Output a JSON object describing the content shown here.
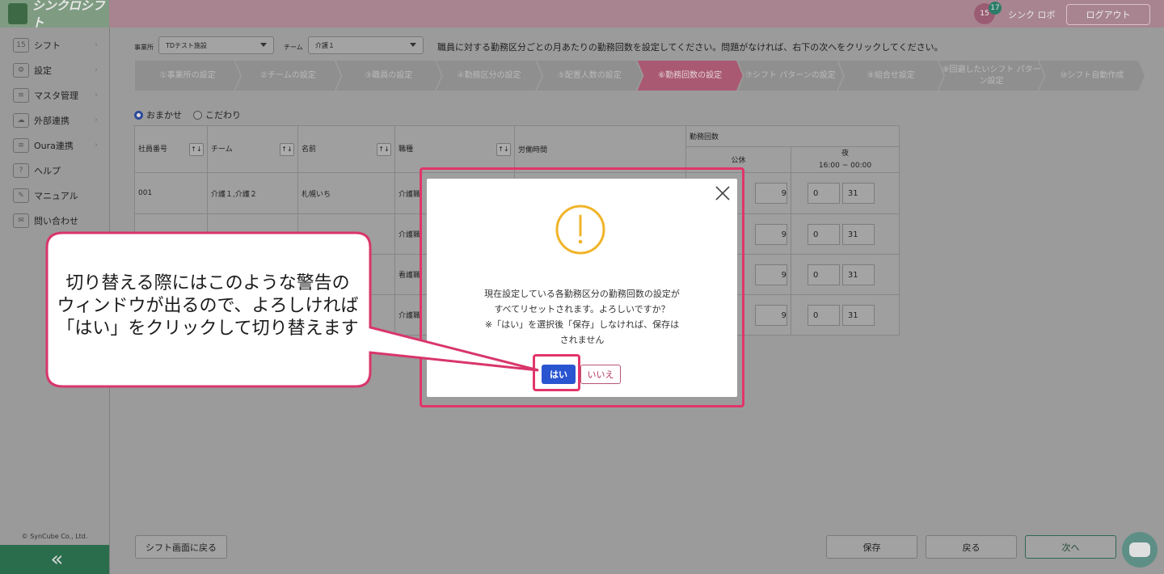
{
  "app": {
    "logo_text": "シンクロシフト",
    "copyright": "© SynCube Co., Ltd.",
    "collapse_symbol": "«"
  },
  "sidebar": {
    "items": [
      {
        "label": "シフト",
        "icon": "calendar-icon"
      },
      {
        "label": "設定",
        "icon": "gear-icon"
      },
      {
        "label": "マスタ管理",
        "icon": "database-icon"
      },
      {
        "label": "外部連携",
        "icon": "cloud-icon"
      },
      {
        "label": "Oura連携",
        "icon": "database-icon"
      },
      {
        "label": "ヘルプ",
        "icon": "help-icon"
      },
      {
        "label": "マニュアル",
        "icon": "edit-icon"
      },
      {
        "label": "問い合わせ",
        "icon": "mail-icon"
      }
    ]
  },
  "header": {
    "calendar_day": "15",
    "notification_count": "17",
    "user_name": "シンク ロボ",
    "logout_label": "ログアウト"
  },
  "filters": {
    "facility_label": "事業所",
    "facility_value": "TDテスト施設",
    "team_label": "チーム",
    "team_value": "介護１"
  },
  "instruction": "職員に対する勤務区分ごとの月あたりの勤務回数を設定してください。問題がなければ、右下の次へをクリックしてください。",
  "steps": [
    {
      "label": "①事業所の設定"
    },
    {
      "label": "②チームの設定"
    },
    {
      "label": "③職員の設定"
    },
    {
      "label": "④勤務区分の設定"
    },
    {
      "label": "⑤配置人数の設定"
    },
    {
      "label": "⑥勤務回数の設定"
    },
    {
      "label": "⑦シフト パターンの設定"
    },
    {
      "label": "⑧組合せ設定"
    },
    {
      "label": "⑨回避したいシフト パターン設定"
    },
    {
      "label": "⑩シフト自動作成"
    }
  ],
  "mode": {
    "option1": "おまかせ",
    "option2": "こだわり",
    "selected": "おまかせ"
  },
  "table": {
    "headers": {
      "id": "社員番号",
      "team": "チーム",
      "name": "名前",
      "job": "職種",
      "hours": "労働時間",
      "counts": "勤務回数",
      "col_off": "公休",
      "col_night": "夜",
      "col_night_time": "16:00 ~ 00:00"
    },
    "rows": [
      {
        "id": "001",
        "team": "介護１,介護２",
        "name": "札幌いち",
        "job": "介護職",
        "off_max": "9",
        "night_min": "0",
        "night_max": "31"
      },
      {
        "id": "",
        "team": "",
        "name": "",
        "job": "介護職",
        "off_max": "9",
        "night_min": "0",
        "night_max": "31"
      },
      {
        "id": "",
        "team": "",
        "name": "",
        "job": "看護職",
        "off_max": "9",
        "night_min": "0",
        "night_max": "31"
      },
      {
        "id": "",
        "team": "",
        "name": "",
        "job": "介護職",
        "off_max": "9",
        "night_min": "0",
        "night_max": "31"
      }
    ]
  },
  "footer": {
    "back_to_shift": "シフト画面に戻る",
    "save": "保存",
    "back": "戻る",
    "next": "次へ"
  },
  "modal": {
    "line1": "現在設定している各勤務区分の勤務回数の設定が",
    "line2": "すべてリセットされます。よろしいですか？",
    "line3": "※「はい」を選択後「保存」しなければ、保存は",
    "line4": "されません",
    "yes": "はい",
    "no": "いいえ"
  },
  "callout": {
    "line1": "切り替える際にはこのような警告の",
    "line2": "ウィンドウが出るので、よろしければ",
    "line3": "「はい」をクリックして切り替えます"
  },
  "colors": {
    "highlight": "#e2356a",
    "primary_button": "#2a55d0",
    "warning": "#f0b429"
  }
}
